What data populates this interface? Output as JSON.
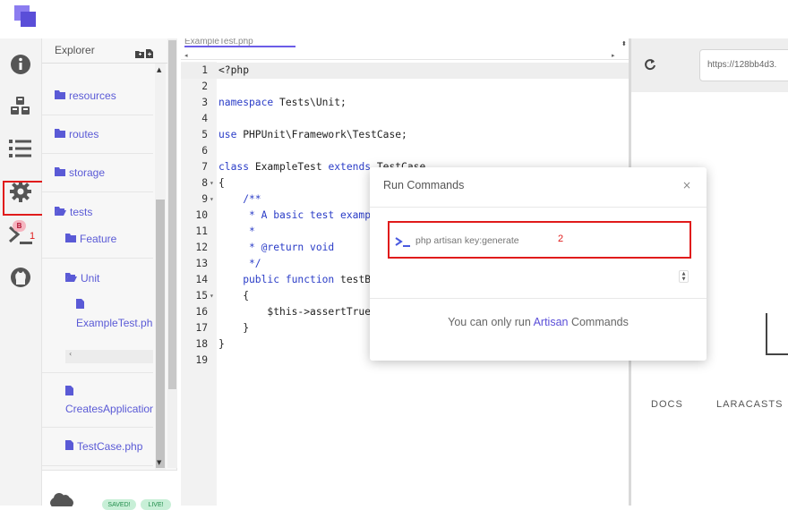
{
  "colors": {
    "accent": "#5a4ed8",
    "annotation": "#e01b1b",
    "folder": "#5a5ad6"
  },
  "activity_icons": [
    "info-icon",
    "cubes-icon",
    "list-icon",
    "gear-icon",
    "terminal-icon",
    "github-icon"
  ],
  "annotations": {
    "terminal_number": "1",
    "command_number": "2",
    "badge": "B"
  },
  "explorer": {
    "title": "Explorer",
    "items": [
      {
        "label": "resources",
        "icon": "folder-icon"
      },
      {
        "label": "routes",
        "icon": "folder-icon"
      },
      {
        "label": "storage",
        "icon": "folder-icon"
      },
      {
        "label": "tests",
        "icon": "folder-open-icon"
      },
      {
        "label": "Feature",
        "icon": "folder-icon"
      },
      {
        "label": "Unit",
        "icon": "folder-open-icon"
      },
      {
        "label": "ExampleTest.php",
        "icon": "file-icon"
      },
      {
        "label": "CreatesApplication.php",
        "icon": "file-icon"
      },
      {
        "label": "TestCase.php",
        "icon": "file-icon"
      }
    ],
    "status": {
      "saved": "SAVED!",
      "live": "LIVE!"
    }
  },
  "editor": {
    "tab_label": "ExampleTest.php",
    "lines": [
      {
        "n": "1",
        "text": "<?php"
      },
      {
        "n": "2",
        "text": ""
      },
      {
        "n": "3",
        "kw": "namespace",
        "text": " Tests\\Unit;"
      },
      {
        "n": "4",
        "text": ""
      },
      {
        "n": "5",
        "kw": "use",
        "text": " PHPUnit\\Framework\\TestCase;"
      },
      {
        "n": "6",
        "text": ""
      },
      {
        "n": "7",
        "kw": "class",
        "text": " ExampleTest ",
        "kw2": "extends",
        "text2": " TestCase"
      },
      {
        "n": "8",
        "text": "{"
      },
      {
        "n": "9",
        "cm": "    /**"
      },
      {
        "n": "10",
        "cm": "     * A basic test example."
      },
      {
        "n": "11",
        "cm": "     *"
      },
      {
        "n": "12",
        "cm": "     * @return void"
      },
      {
        "n": "13",
        "cm": "     */"
      },
      {
        "n": "14",
        "kw": "    public function",
        "text": " testBasicTest()"
      },
      {
        "n": "15",
        "text": "    {"
      },
      {
        "n": "16",
        "text": "        $this->assertTrue(true);"
      },
      {
        "n": "17",
        "text": "    }"
      },
      {
        "n": "18",
        "text": "}"
      },
      {
        "n": "19",
        "text": ""
      }
    ]
  },
  "preview": {
    "url": "https://128bb4d3.",
    "links": [
      "DOCS",
      "LARACASTS"
    ]
  },
  "modal": {
    "title": "Run Commands",
    "close": "×",
    "input_placeholder": "php artisan key:generate",
    "footer_prefix": "You can only run ",
    "footer_accent": "Artisan",
    "footer_suffix": " Commands"
  }
}
